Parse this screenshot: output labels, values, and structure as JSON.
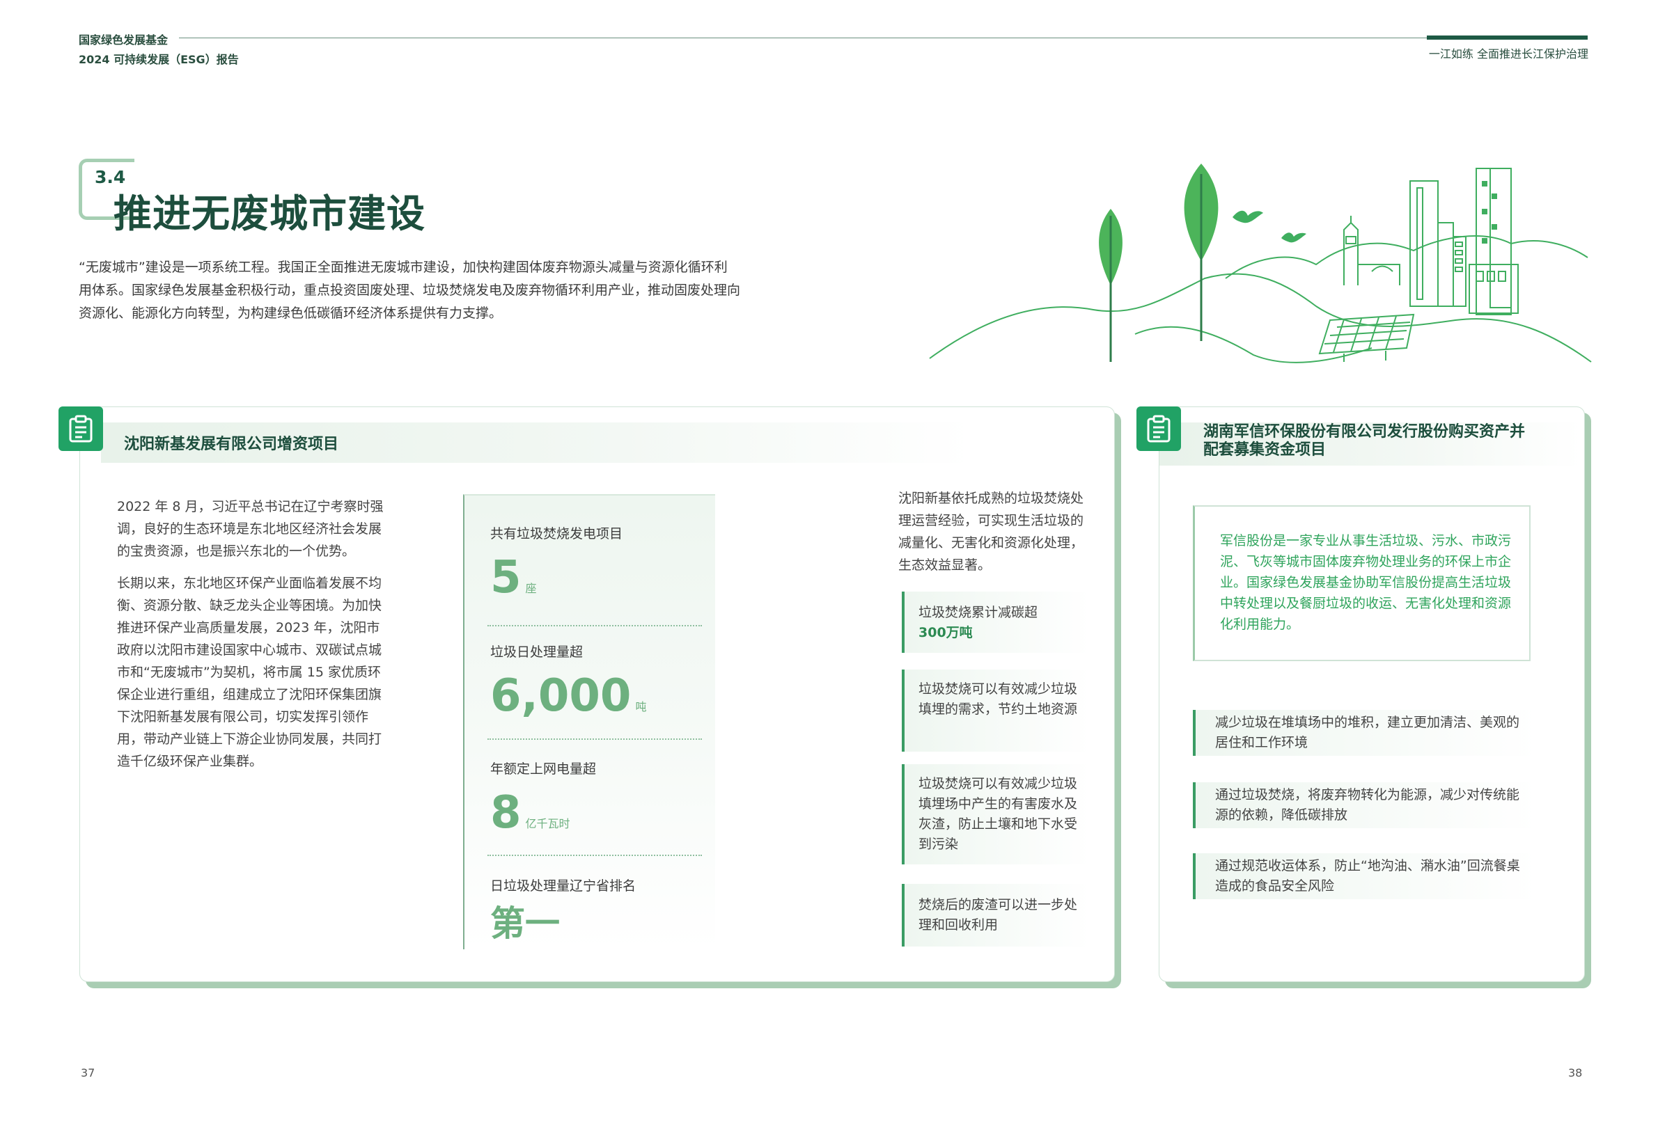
{
  "header": {
    "org": "国家绿色发展基金",
    "report": "2024 可持续发展（ESG）报告",
    "section_right": "一江如练 全面推进长江保护治理"
  },
  "section": {
    "number": "3.4",
    "title": "推进无废城市建设",
    "intro": "“无废城市”建设是一项系统工程。我国正全面推进无废城市建设，加快构建固体废弃物源头减量与资源化循环利用体系。国家绿色发展基金积极行动，重点投资固废处理、垃圾焚烧发电及废弃物循环利用产业，推动固废处理向资源化、能源化方向转型，为构建绿色低碳循环经济体系提供有力支撑。"
  },
  "left_card": {
    "title": "沈阳新基发展有限公司增资项目",
    "paragraphs": [
      "2022 年 8 月，习近平总书记在辽宁考察时强调，良好的生态环境是东北地区经济社会发展的宝贵资源，也是振兴东北的一个优势。",
      "长期以来，东北地区环保产业面临着发展不均衡、资源分散、缺乏龙头企业等困境。为加快推进环保产业高质量发展，2023 年，沈阳市政府以沈阳市建设国家中心城市、双碳试点城市和“无废城市”为契机，将市属 15 家优质环保企业进行重组，组建成立了沈阳环保集团旗下沈阳新基发展有限公司，切实发挥引领作用，带动产业链上下游企业协同发展，共同打造千亿级环保产业集群。"
    ],
    "stats": [
      {
        "label": "共有垃圾焚烧发电项目",
        "value": "5",
        "unit": "座"
      },
      {
        "label": "垃圾日处理量超",
        "value": "6,000",
        "unit": "吨"
      },
      {
        "label": "年额定上网电量超",
        "value": "8",
        "unit": "亿千瓦时"
      },
      {
        "label": "日垃圾处理量辽宁省排名",
        "value": "第一",
        "unit": ""
      }
    ],
    "right_intro": "沈阳新基依托成熟的垃圾焚烧处理运营经验，可实现生活垃圾的减量化、无害化和资源化处理，生态效益显著。",
    "benefits": [
      {
        "line1": "垃圾焚烧累计减碳超",
        "strong": "300万吨"
      },
      {
        "text": "垃圾焚烧可以有效减少垃圾填埋的需求，节约土地资源"
      },
      {
        "text": "垃圾焚烧可以有效减少垃圾填埋场中产生的有害废水及灰渣，防止土壤和地下水受到污染"
      },
      {
        "text": "焚烧后的废渣可以进一步处理和回收利用"
      }
    ]
  },
  "right_card": {
    "title_line1": "湖南军信环保股份有限公司发行股份购买资产并",
    "title_line2": "配套募集资金项目",
    "quote": "军信股份是一家专业从事生活垃圾、污水、市政污泥、飞灰等城市固体废弃物处理业务的环保上市企业。国家绿色发展基金协助军信股份提高生活垃圾中转处理以及餐厨垃圾的收运、无害化处理和资源化利用能力。",
    "benefits": [
      "减少垃圾在堆填场中的堆积，建立更加清洁、美观的居住和工作环境",
      "通过垃圾焚烧，将废弃物转化为能源，减少对传统能源的依赖，降低碳排放",
      "通过规范收运体系，防止“地沟油、潲水油”回流餐桌造成的食品安全风险"
    ]
  },
  "pages": {
    "left": "37",
    "right": "38"
  },
  "colors": {
    "primary_dark": "#1d4e3d",
    "accent_green": "#21a265",
    "light_green": "#6db07f",
    "shadow_green": "#a9cdb3"
  }
}
